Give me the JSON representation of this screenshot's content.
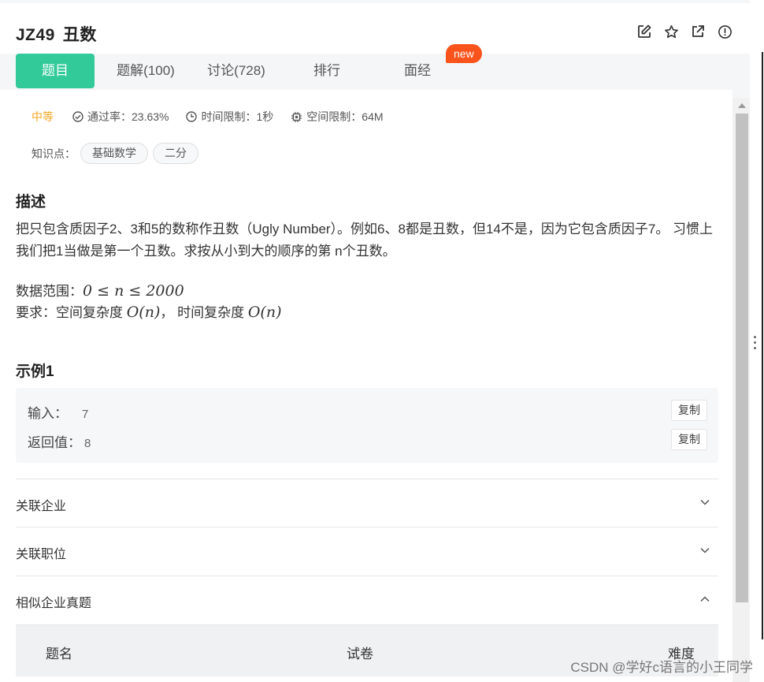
{
  "header": {
    "code": "JZ49",
    "name": "丑数",
    "icons": [
      "edit-icon",
      "star-icon",
      "external-link-icon",
      "info-icon"
    ]
  },
  "tabs": [
    {
      "label": "题目",
      "active": true
    },
    {
      "label": "题解(100)",
      "active": false
    },
    {
      "label": "讨论(728)",
      "active": false
    },
    {
      "label": "排行",
      "active": false
    },
    {
      "label": "面经",
      "active": false
    }
  ],
  "new_badge": "new",
  "meta": {
    "difficulty": "中等",
    "pass_rate": "通过率：23.63%",
    "time_limit": "时间限制：1秒",
    "space_limit": "空间限制：64M"
  },
  "knowledge": {
    "label": "知识点：",
    "tags": [
      "基础数学",
      "二分"
    ]
  },
  "description": {
    "heading": "描述",
    "text": "把只包含质因子2、3和5的数称作丑数（Ugly Number）。例如6、8都是丑数，但14不是，因为它包含质因子7。 习惯上我们把1当做是第一个丑数。求按从小到大的顺序的第 n个丑数。",
    "range_label": "数据范围：",
    "range_math": "0 ≤ n ≤ 2000",
    "req_label": "要求：空间复杂度",
    "req_space": "O(n)",
    "req_sep": "，  时间复杂度",
    "req_time": "O(n)"
  },
  "example": {
    "heading": "示例1",
    "input_label": "输入：",
    "input_value": "7",
    "output_label": "返回值：",
    "output_value": "8",
    "copy_label": "复制"
  },
  "accordions": [
    {
      "label": "关联企业",
      "expanded": false
    },
    {
      "label": "关联职位",
      "expanded": false
    },
    {
      "label": "相似企业真题",
      "expanded": true
    }
  ],
  "table": {
    "columns": [
      "题名",
      "试卷",
      "难度"
    ]
  },
  "watermark": "CSDN @学好c语言的小王同学",
  "colors": {
    "accent": "#32ca99",
    "badge": "#fa541c",
    "difficulty": "#f5a623"
  }
}
